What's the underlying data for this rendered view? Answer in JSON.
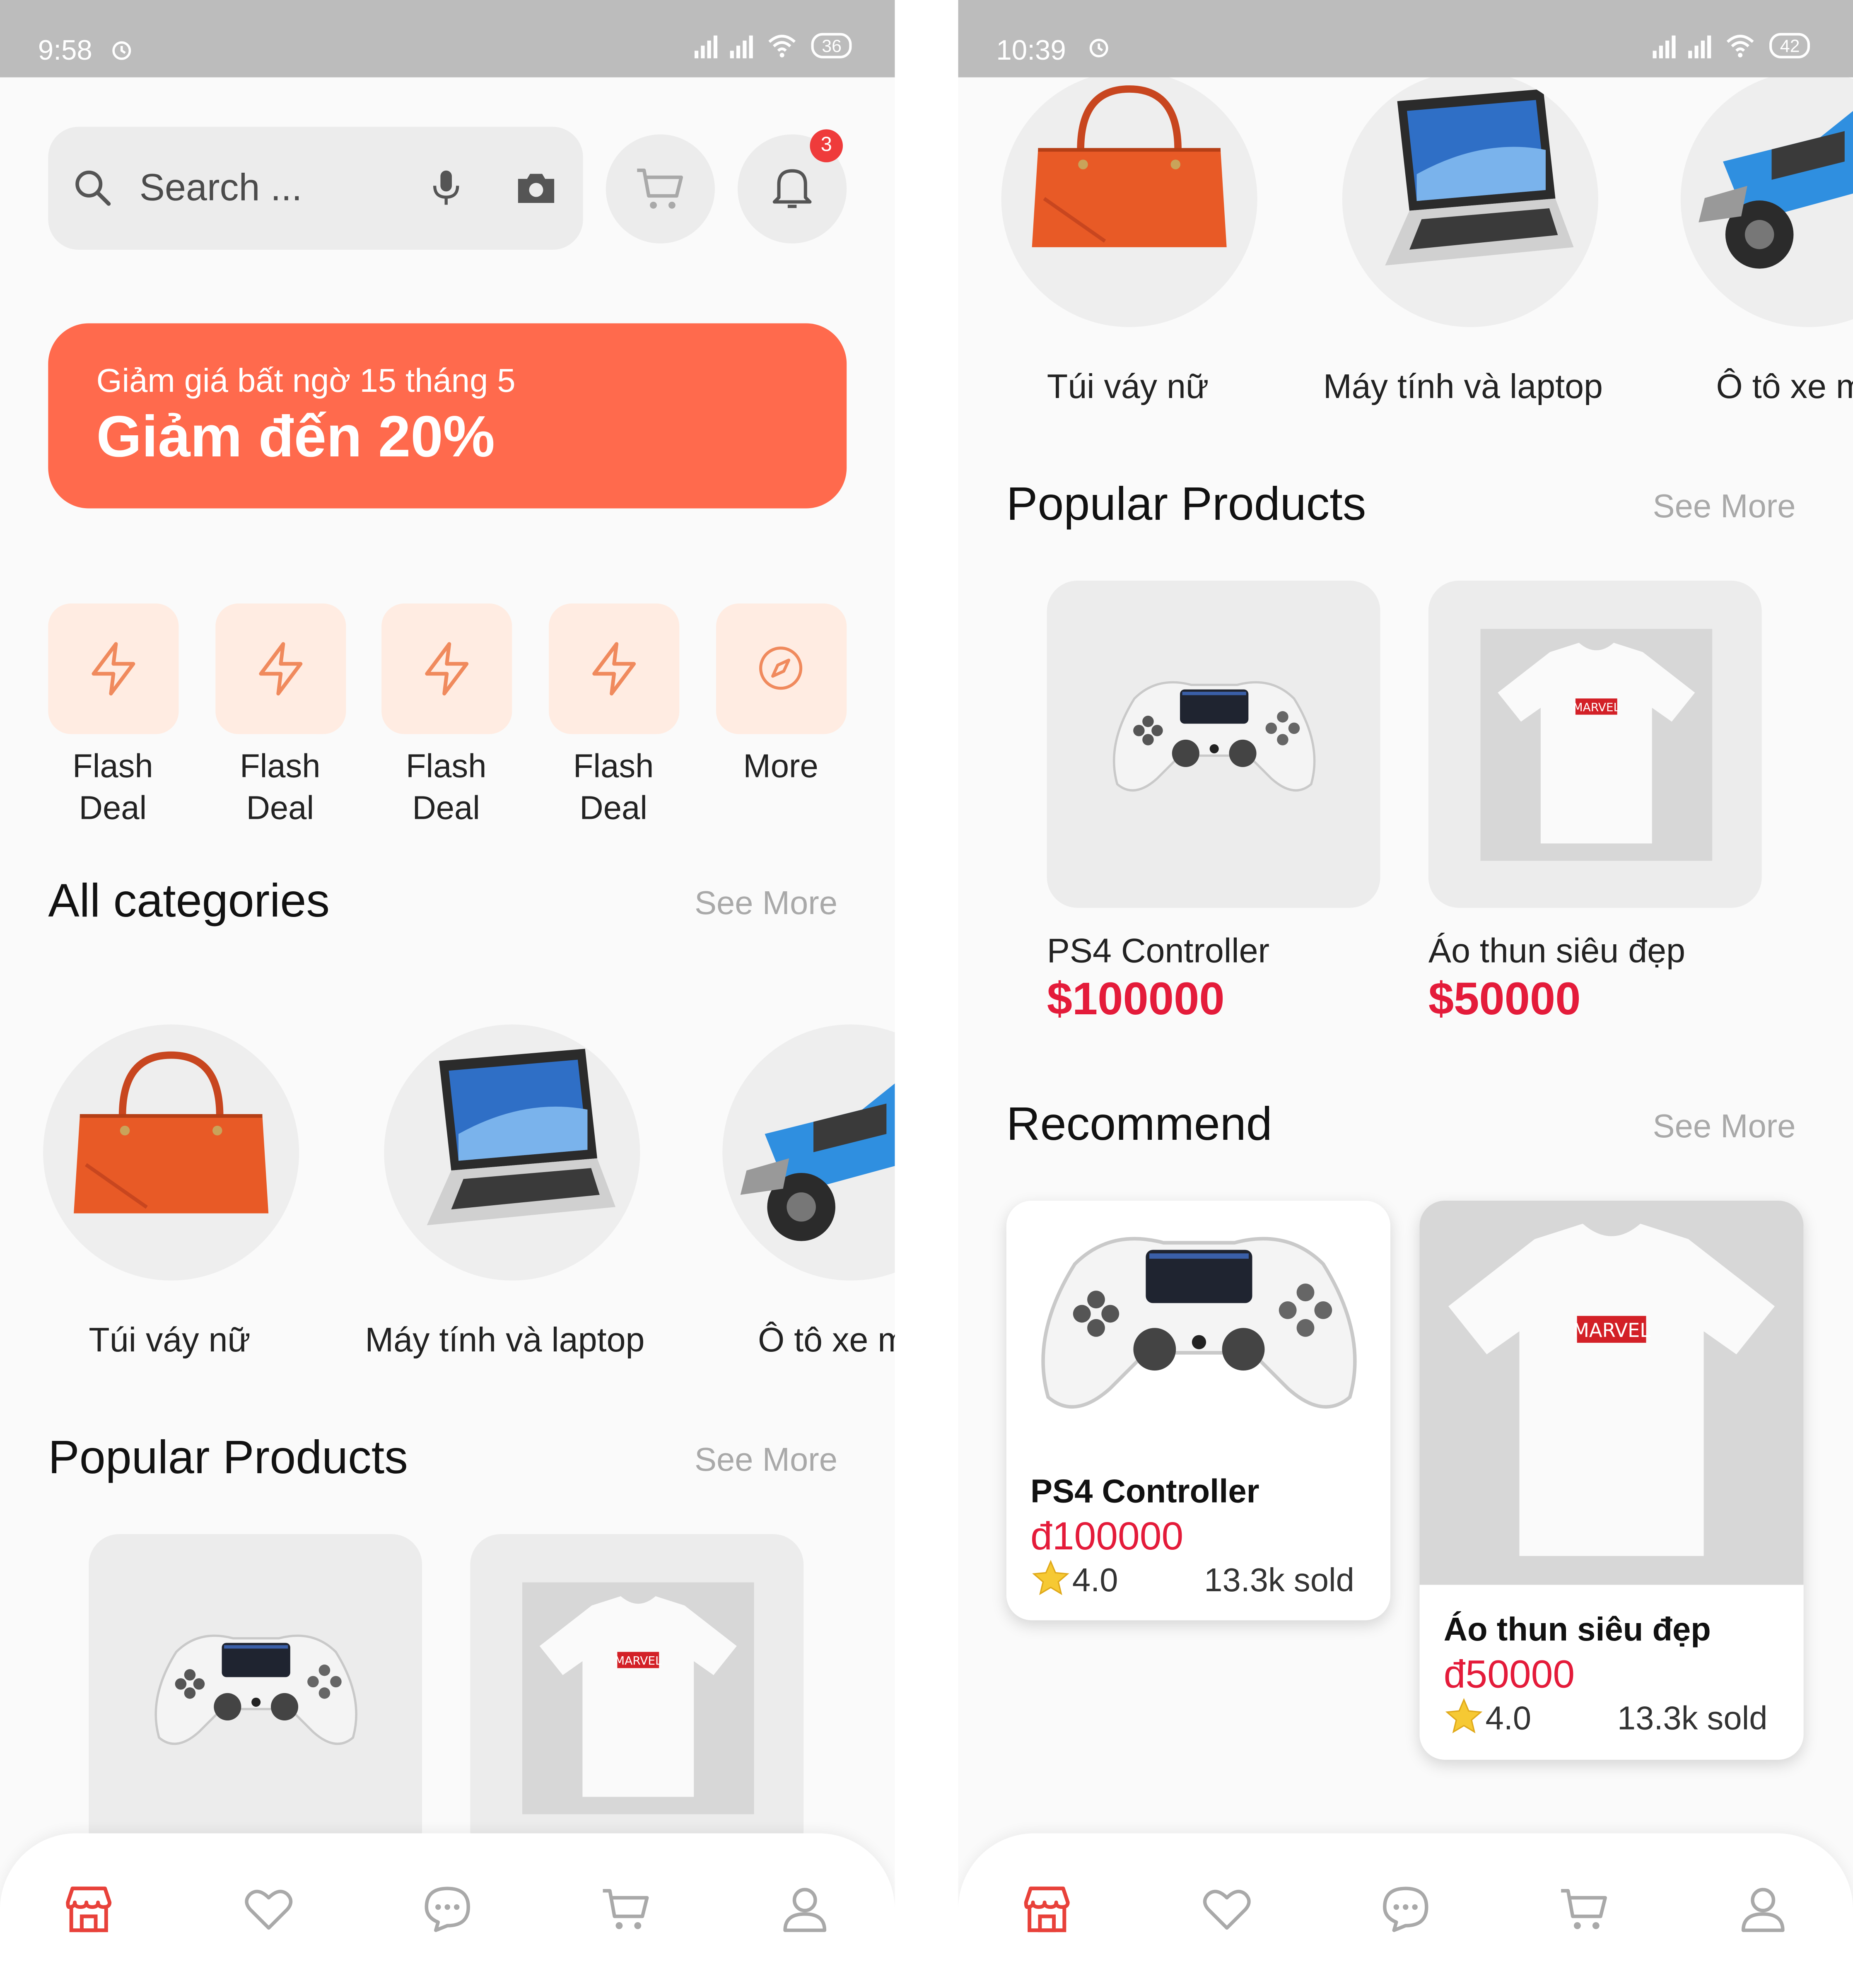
{
  "left": {
    "status": {
      "time": "9:58",
      "battery": "36"
    },
    "search": {
      "placeholder": "Search ..."
    },
    "notifications": {
      "count": "3"
    },
    "banner": {
      "subtitle": "Giảm giá bất ngờ 15 tháng 5",
      "title": "Giảm đến 20%"
    },
    "quick_actions": [
      {
        "label_1": "Flash",
        "label_2": "Deal",
        "icon": "lightning-icon"
      },
      {
        "label_1": "Flash",
        "label_2": "Deal",
        "icon": "lightning-icon"
      },
      {
        "label_1": "Flash",
        "label_2": "Deal",
        "icon": "lightning-icon"
      },
      {
        "label_1": "Flash",
        "label_2": "Deal",
        "icon": "lightning-icon"
      },
      {
        "label_1": "More",
        "label_2": "",
        "icon": "compass-icon"
      }
    ],
    "categories": {
      "title": "All categories",
      "see_more": "See More",
      "items": [
        {
          "label": "Túi váy nữ"
        },
        {
          "label": "Máy tính và laptop"
        },
        {
          "label": "Ô tô xe m"
        }
      ]
    },
    "popular": {
      "title": "Popular Products",
      "see_more": "See More"
    }
  },
  "right": {
    "status": {
      "time": "10:39",
      "battery": "42"
    },
    "categories": {
      "items": [
        {
          "label": "Túi váy nữ"
        },
        {
          "label": "Máy tính và laptop"
        },
        {
          "label": "Ô tô xe m"
        }
      ]
    },
    "popular": {
      "title": "Popular Products",
      "see_more": "See More",
      "products": [
        {
          "name": "PS4 Controller",
          "price": "$100000"
        },
        {
          "name": "Áo thun siêu đẹp",
          "price": "$50000"
        }
      ]
    },
    "recommend": {
      "title": "Recommend",
      "see_more": "See More",
      "products": [
        {
          "name": "PS4 Controller",
          "price": "đ100000",
          "rating": "4.0",
          "sold": "13.3k sold"
        },
        {
          "name": "Áo thun siêu đẹp",
          "price": "đ50000",
          "rating": "4.0",
          "sold": "13.3k sold"
        }
      ]
    }
  },
  "nav": {
    "items": [
      "shop-icon",
      "heart-icon",
      "chat-icon",
      "cart-icon",
      "user-icon"
    ]
  },
  "colors": {
    "accent": "#ff6a4d",
    "price": "#e41b3a",
    "tile_bg": "#ffece2",
    "icon_orange": "#f08a5d"
  }
}
